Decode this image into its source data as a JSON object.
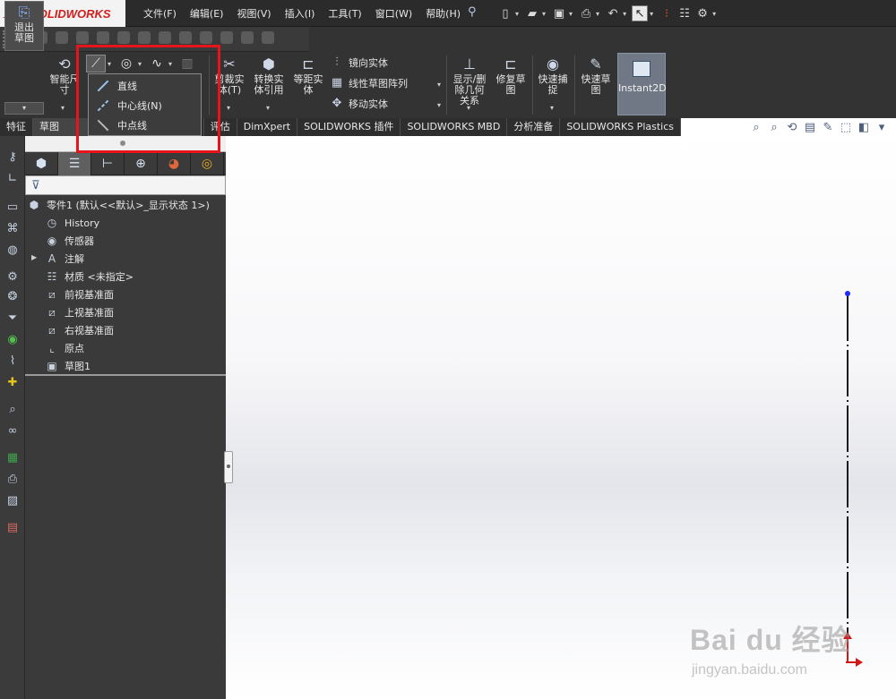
{
  "app": {
    "brand_prefix": "DS",
    "brand_name": "SOLIDWORKS"
  },
  "menu": [
    {
      "label": "文件(F)"
    },
    {
      "label": "编辑(E)"
    },
    {
      "label": "视图(V)"
    },
    {
      "label": "插入(I)"
    },
    {
      "label": "工具(T)"
    },
    {
      "label": "窗口(W)"
    },
    {
      "label": "帮助(H)"
    }
  ],
  "quick_access": [
    "new-file-icon",
    "open-icon",
    "save-icon",
    "print-icon",
    "undo-icon",
    "select-icon",
    "traffic-light-icon",
    "options-list-icon",
    "gear-icon"
  ],
  "ribbon": {
    "exit_sketch": "退出草图",
    "smart_dimension": "智能尺寸",
    "trim": "剪裁实体(T)",
    "convert": "转换实体引用",
    "offset": "等距实体",
    "mirror": "镜向实体",
    "linear_pattern": "线性草图阵列",
    "move": "移动实体",
    "display_delete_relations": "显示/删除几何关系",
    "repair_sketch": "修复草图",
    "quick_snaps": "快速捕捉",
    "rapid_sketch": "快速草图",
    "instant2d": "Instant2D"
  },
  "line_dropdown": {
    "items": [
      {
        "label": "直线"
      },
      {
        "label": "中心线(N)"
      },
      {
        "label": "中点线"
      }
    ]
  },
  "tabs": [
    {
      "label": "特征"
    },
    {
      "label": "草图"
    },
    {
      "label": "件"
    },
    {
      "label": "评估"
    },
    {
      "label": "DimXpert"
    },
    {
      "label": "SOLIDWORKS 插件"
    },
    {
      "label": "SOLIDWORKS MBD"
    },
    {
      "label": "分析准备"
    },
    {
      "label": "SOLIDWORKS Plastics"
    }
  ],
  "feature_tree": {
    "root": "零件1 (默认<<默认>_显示状态 1>)",
    "items": [
      {
        "label": "History",
        "icon": "history-icon"
      },
      {
        "label": "传感器",
        "icon": "sensor-icon"
      },
      {
        "label": "注解",
        "icon": "annotation-icon"
      },
      {
        "label": "材质 <未指定>",
        "icon": "material-icon"
      },
      {
        "label": "前视基准面",
        "icon": "plane-icon"
      },
      {
        "label": "上视基准面",
        "icon": "plane-icon"
      },
      {
        "label": "右视基准面",
        "icon": "plane-icon"
      },
      {
        "label": "原点",
        "icon": "origin-icon"
      },
      {
        "label": "草图1",
        "icon": "sketch-icon"
      }
    ]
  },
  "watermark": {
    "main": "Bai du 经验",
    "sub": "jingyan.baidu.com"
  },
  "colors": {
    "highlight": "#e8141b",
    "sketch_point": "#1a2cff",
    "origin": "#d01818"
  }
}
